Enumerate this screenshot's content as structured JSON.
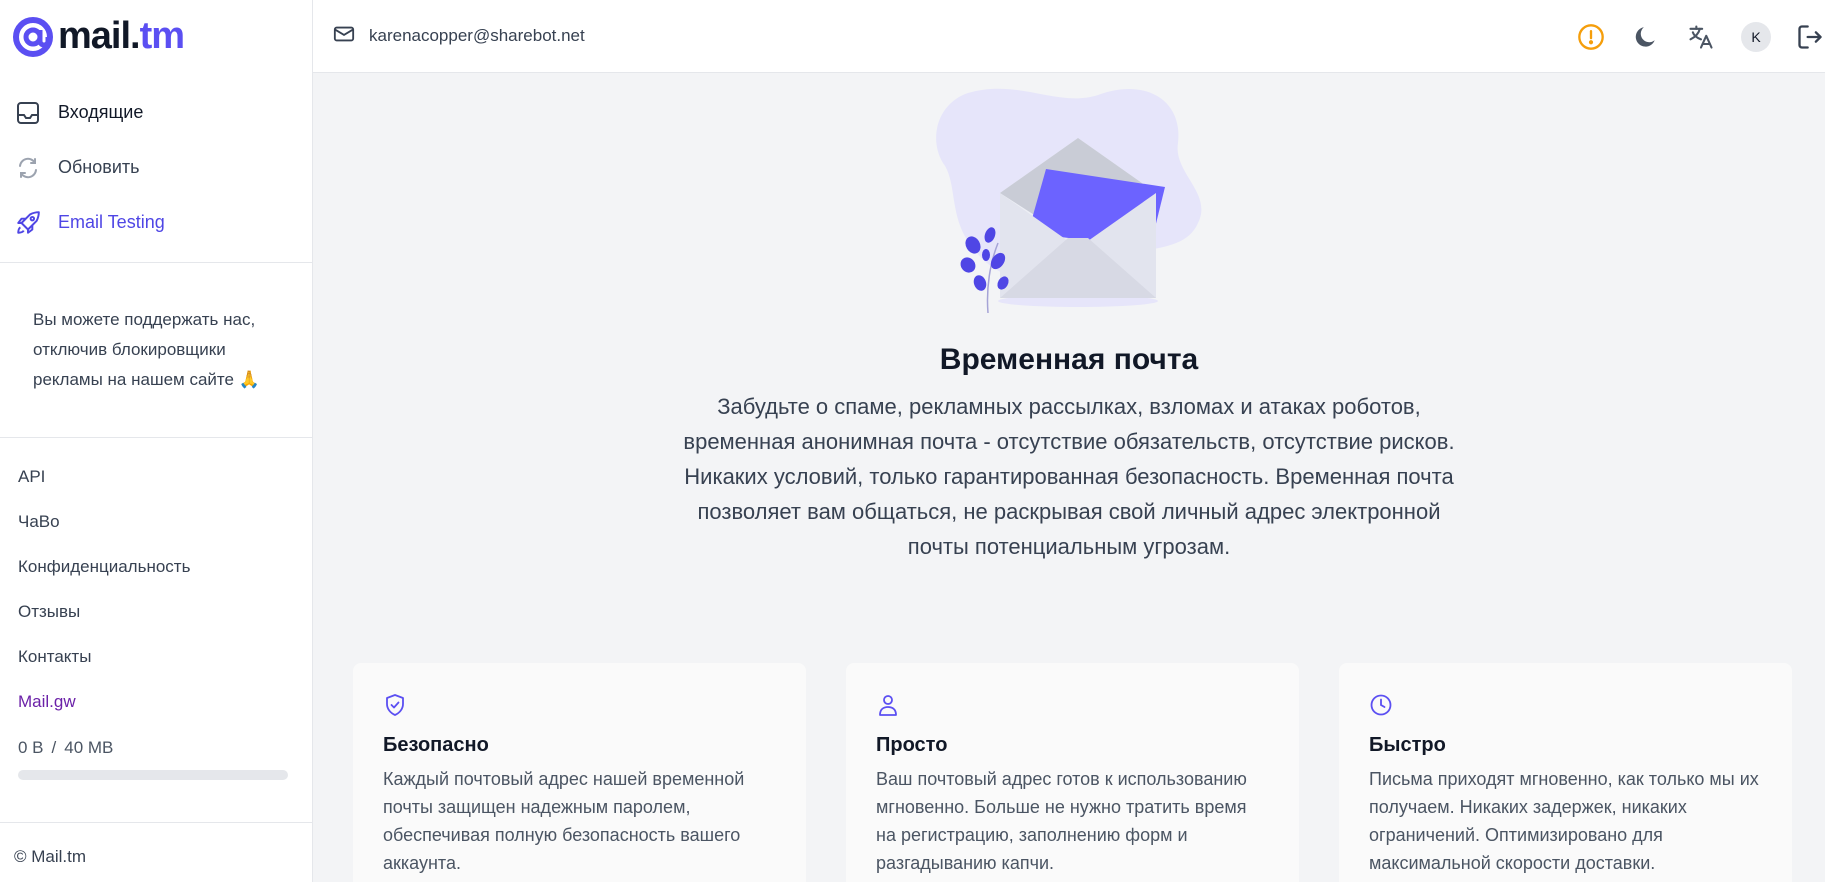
{
  "brand": {
    "prefix": "mail.",
    "suffix": "tm"
  },
  "nav": {
    "inbox": "Входящие",
    "refresh": "Обновить",
    "testing": "Email Testing"
  },
  "support_text": "Вы можете поддержать нас, отключив блокировщики рекламы на нашем сайте 🙏",
  "links": {
    "api": "API",
    "faq": "ЧаВо",
    "privacy": "Конфиденциальность",
    "reviews": "Отзывы",
    "contacts": "Контакты",
    "gw": "Mail.gw"
  },
  "storage": {
    "used": "0 B",
    "separator": "/",
    "total": "40 MB",
    "fraction": 0.0
  },
  "footer": "© Mail.tm",
  "header": {
    "email": "karenacopper@sharebot.net",
    "avatar_initial": "K"
  },
  "hero": {
    "title": "Временная почта",
    "description": "Забудьте о спаме, рекламных рассылках, взломах и атаках роботов, временная анонимная почта - отсутствие обязательств, отсутствие рисков. Никаких условий, только гарантированная безопасность. Временная почта позволяет вам общаться, не раскрывая свой личный адрес электронной почты потенциальным угрозам."
  },
  "cards": [
    {
      "icon": "shield-check-icon",
      "title": "Безопасно",
      "text": "Каждый почтовый адрес нашей временной почты защищен надежным паролем, обеспечивая полную безопасность вашего аккаунта."
    },
    {
      "icon": "user-icon",
      "title": "Просто",
      "text": "Ваш почтовый адрес готов к использованию мгновенно. Больше не нужно тратить время на регистрацию, заполнению форм и разгадыванию капчи."
    },
    {
      "icon": "clock-icon",
      "title": "Быстро",
      "text": "Письма приходят мгновенно, как только мы их получаем. Никаких задержек, никаких ограничений. Оптимизировано для максимальной скорости доставки."
    }
  ],
  "colors": {
    "accent": "#5b4ff2",
    "warning": "#f59e0b",
    "link_purple": "#6b21a8"
  }
}
